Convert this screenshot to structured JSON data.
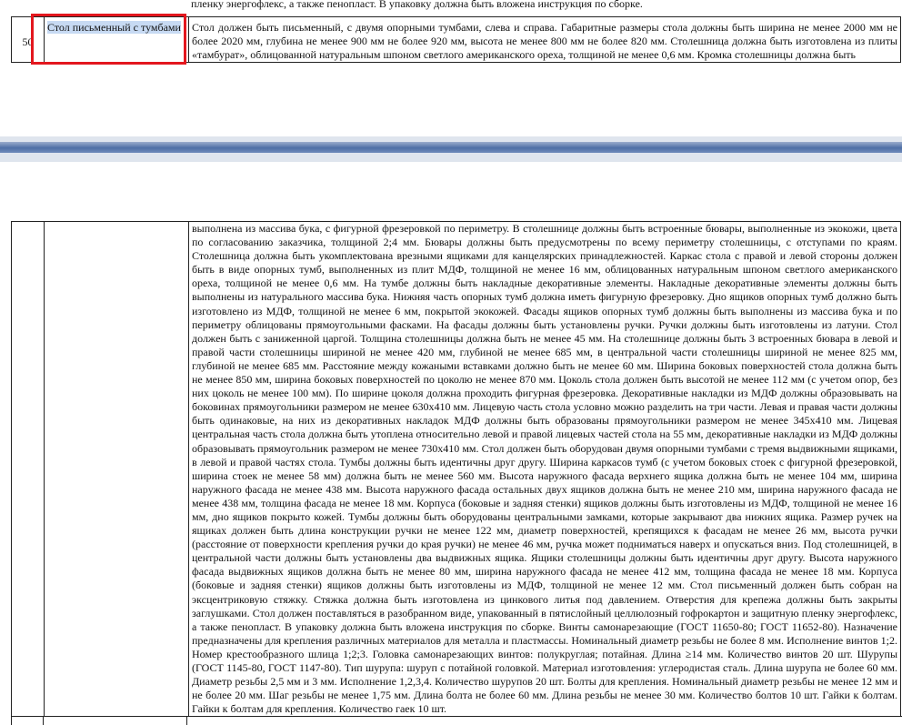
{
  "page1": {
    "top_fragment": "пленку энергофлекс, а также пенопласт.  В упаковку должна быть вложена инструкция  по сборке.",
    "row_number": "50",
    "item_name": "Стол письменный  с тумбами",
    "description_start": "Стол должен быть письменный, с двумя опорными тумбами, слева и справа. Габаритные размеры стола должны быть ширина не менее 2000 мм не более 2020 мм, глубина не менее 900 мм не более 920 мм, высота не менее 800 мм не более 820 мм. Столешница должна быть изготовлена из плиты «тамбурат», облицованной натуральным шпоном светлого американского ореха, толщиной не менее 0,6 мм. Кромка столешницы должна быть"
  },
  "page2": {
    "description_continued": "выполнена из массива бука, с фигурной фрезеровкой по периметру. В столешнице должны быть встроенные бювары, выполненные из экокожи, цвета по согласованию заказчика, толщиной 2;4 мм. Бювары должны быть предусмотрены по всему периметру столешницы, с отступами по краям. Столешница должна быть укомплектована врезными ящиками для канцелярских принадлежностей. Каркас стола с правой и левой стороны должен быть в виде опорных тумб, выполненных из плит МДФ, толщиной не менее 16 мм, облицованных натуральным шпоном светлого американского ореха, толщиной не менее 0,6 мм. На тумбе должны быть накладные декоративные элементы. Накладные декоративные элементы должны быть выполнены из натурального массива бука. Нижняя часть опорных тумб должна иметь фигурную фрезеровку. Дно ящиков опорных тумб должно быть изготовлено из МДФ, толщиной не менее 6 мм, покрытой экокожей. Фасады ящиков опорных тумб должны быть выполнены из массива бука и по периметру облицованы прямоугольными фасками. На фасады должны быть установлены ручки. Ручки должны быть изготовлены из латуни. Стол должен быть с заниженной царгой. Толщина столешницы должна быть не менее 45 мм. На столешнице должны быть 3 встроенных бювара в левой и правой части столешницы шириной не менее 420 мм, глубиной не менее 685 мм, в центральной части столешницы шириной не менее 825 мм, глубиной не менее 685 мм. Расстояние между кожаными вставками должно быть не менее 60 мм. Ширина боковых поверхностей стола должна быть не менее 850 мм, ширина боковых поверхностей по цоколю не менее 870 мм. Цоколь стола должен быть высотой не менее 112 мм (с учетом опор, без них цоколь не менее 100 мм). По ширине цоколя должна проходить фигурная фрезеровка. Декоративные накладки из МДФ должны образовывать на боковинах прямоугольники размером не менее 630х410 мм. Лицевую часть стола условно можно разделить на три части. Левая и правая части должны быть одинаковые, на них из декоративных накладок МДФ должны быть образованы прямоугольники размером не менее 345х410 мм. Лицевая центральная часть стола должна быть утоплена относительно левой и правой лицевых частей стола на 55 мм, декоративные накладки из МДФ должны образовывать прямоугольник размером не менее 730х410 мм. Стол должен быть оборудован двумя опорными тумбами с тремя выдвижными ящиками, в левой и правой частях стола. Тумбы должны быть идентичны друг другу. Ширина каркасов тумб (с учетом боковых стоек с фигурной фрезеровкой, ширина стоек не менее 58 мм) должна быть не менее 560 мм. Высота наружного фасада верхнего ящика должна быть не менее 104 мм, ширина наружного фасада не менее 438 мм. Высота наружного фасада остальных двух ящиков должна быть не менее 210 мм, ширина наружного фасада не менее 438 мм, толщина фасада не менее 18 мм. Корпуса (боковые и задняя стенки) ящиков должны быть изготовлены из МДФ, толщиной не менее 16 мм, дно ящиков покрыто кожей. Тумбы должны быть оборудованы центральными замками, которые закрывают два нижних ящика. Размер ручек на ящиках должен быть длина конструкции ручки не менее 122 мм, диаметр поверхностей, крепящихся к фасадам не менее 26 мм, высота ручки (расстояние от поверхности крепления ручки до края ручки) не менее 46 мм, ручка может подниматься наверх и опускаться вниз. Под столешницей, в центральной части должны быть установлены два выдвижных ящика. Ящики столешницы должны быть идентичны друг другу. Высота наружного фасада выдвижных ящиков должна быть не менее 80 мм, ширина наружного фасада не менее 412 мм, толщина фасада не менее 18 мм. Корпуса (боковые и задняя стенки) ящиков должны быть изготовлены из МДФ, толщиной не менее 12 мм. Стол письменный должен быть собран на эксцентриковую стяжку. Стяжка должна быть изготовлена из цинкового литья под давлением. Отверстия для крепежа должны быть закрыты заглушками. Стол должен поставляться в разобранном виде, упакованный в пятислойный целлюлозный гофрокартон и защитную пленку энергофлекс, а также пенопласт. В упаковку должна быть вложена инструкция по сборке. Винты самонарезающие (ГОСТ 11650-80; ГОСТ 11652-80). Назначение предназначены для крепления различных материалов для металла и пластмассы. Номинальный диаметр резьбы не более 8 мм. Исполнение винтов 1;2. Номер крестообразного шлица 1;2;3. Головка самонарезающих винтов: полукруглая; потайная. Длина ≥14 мм. Количество винтов 20 шт. Шурупы (ГОСТ 1145-80, ГОСТ 1147-80). Тип шурупа: шуруп с потайной головкой. Материал изготовления: углеродистая сталь. Длина шурупа не более 60 мм. Диаметр резьбы 2,5 мм и 3 мм. Исполнение 1,2,3,4. Количество шурупов 20 шт. Болты для крепления. Номинальный диаметр резьбы не менее 12 мм и не более 20 мм. Шаг резьбы не менее 1,75 мм. Длина болта не более 60 мм. Длина резьбы не менее 30 мм. Количество болтов 10 шт. Гайки к болтам. Гайки к болтам для крепления. Количество гаек 10 шт."
  },
  "colors": {
    "selection_highlight": "#c7daf3",
    "annotation_box": "#e3171e",
    "page_separator": "#4e6fa6"
  }
}
